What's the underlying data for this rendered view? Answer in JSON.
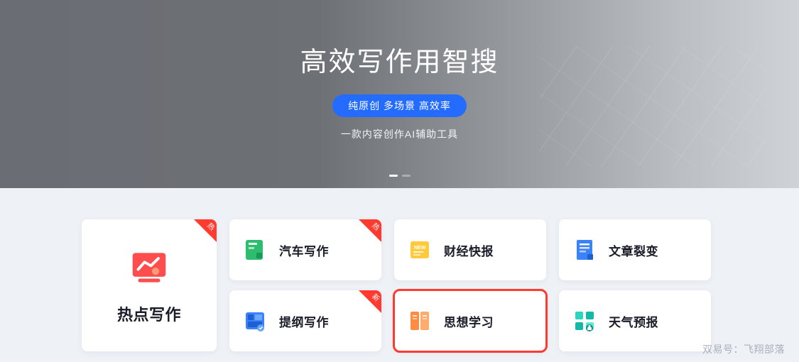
{
  "hero": {
    "title": "高效写作用智搜",
    "tags": "纯原创 多场景 高效率",
    "subtitle": "一款内容创作AI辅助工具"
  },
  "cards": {
    "featured": {
      "label": "热点写作",
      "corner": "热"
    },
    "row1": [
      {
        "label": "汽车写作",
        "corner": "热"
      },
      {
        "label": "财经快报",
        "corner": ""
      },
      {
        "label": "文章裂变",
        "corner": ""
      }
    ],
    "row2": [
      {
        "label": "提纲写作",
        "corner": "新"
      },
      {
        "label": "思想学习",
        "corner": ""
      },
      {
        "label": "天气预报",
        "corner": ""
      }
    ]
  },
  "tags": {
    "hot": "热",
    "new": "新"
  },
  "watermark": "双易号：飞翔部落",
  "colors": {
    "accent": "#246bff",
    "hot": "#ff3b30",
    "new": "#ff3b30"
  }
}
